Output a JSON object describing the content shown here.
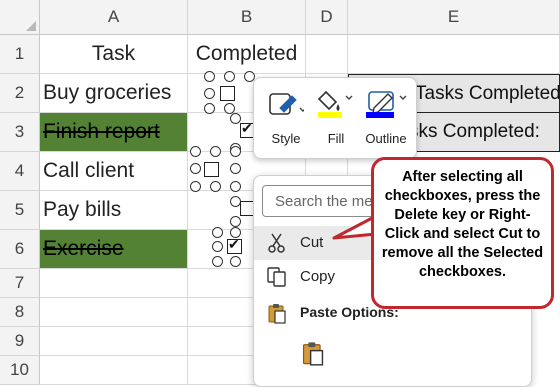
{
  "columns": [
    "A",
    "B",
    "D",
    "E"
  ],
  "rows": [
    "1",
    "2",
    "3",
    "4",
    "5",
    "6",
    "7",
    "8",
    "9",
    "10"
  ],
  "headers": {
    "task": "Task",
    "completed": "Completed"
  },
  "tasks": [
    {
      "label": "Buy groceries",
      "done": false
    },
    {
      "label": "Finish report",
      "done": true
    },
    {
      "label": "Call client",
      "done": false
    },
    {
      "label": "Pay bills",
      "done": false
    },
    {
      "label": "Exercise",
      "done": true
    }
  ],
  "e_column": {
    "row2": "Tasks Completed:",
    "row3": "sks Completed:"
  },
  "mini_toolbar": {
    "style": "Style",
    "fill": "Fill",
    "outline": "Outline"
  },
  "context_menu": {
    "search_placeholder": "Search the me",
    "cut": "Cut",
    "copy": "Copy",
    "paste_options": "Paste Options:"
  },
  "callout": "After selecting all checkboxes, press the Delete key or Right-Click and select Cut to remove all the Selected checkboxes.",
  "colors": {
    "completed_fill": "#548235",
    "callout_border": "#c0282d",
    "fill_accent": "#ffff00",
    "outline_accent": "#0000ff"
  }
}
